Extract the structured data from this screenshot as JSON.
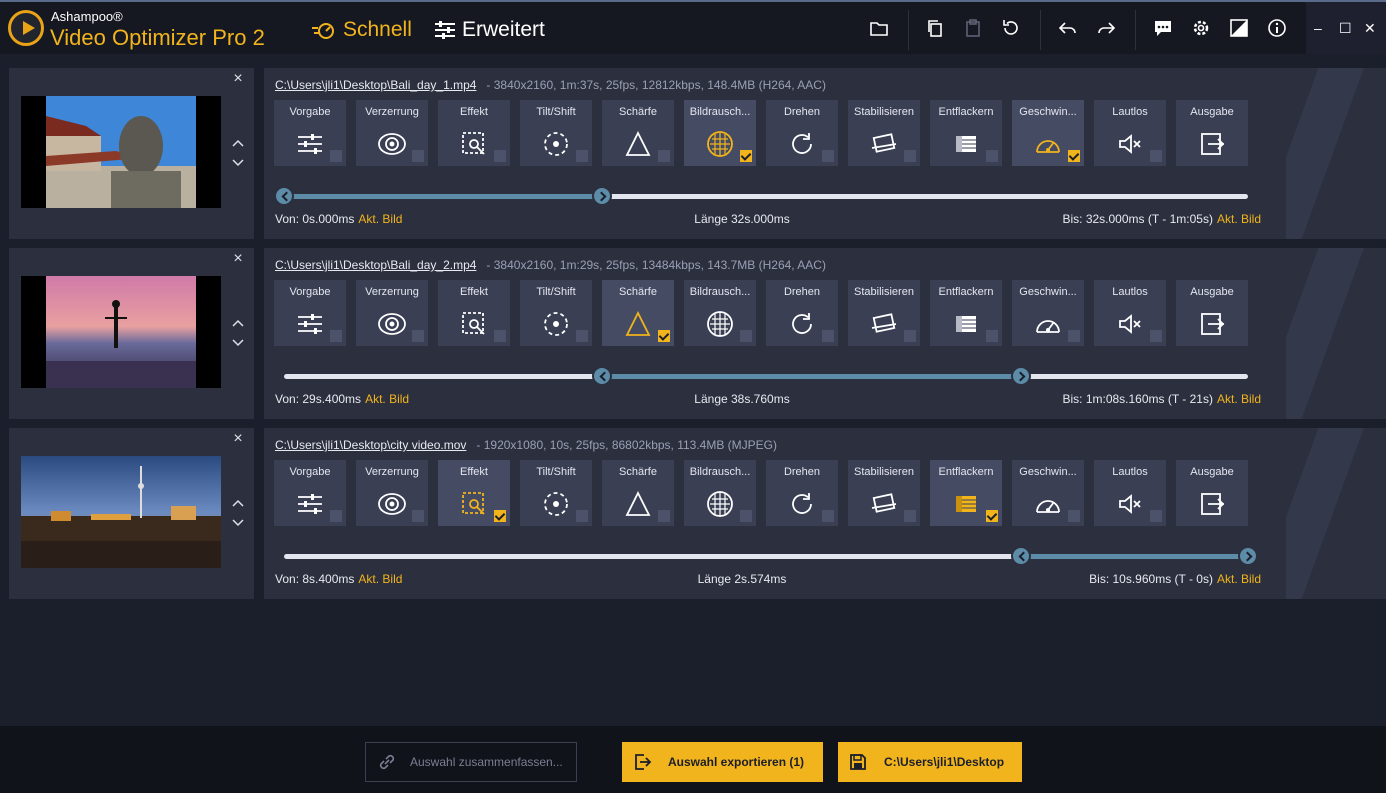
{
  "app": {
    "brand_small": "Ashampoo®",
    "brand_big": "Video Optimizer Pro 2"
  },
  "modes": [
    {
      "label": "Schnell",
      "active": true
    },
    {
      "label": "Erweitert",
      "active": false
    }
  ],
  "window_buttons": {
    "minimize": "–",
    "maximize": "☐",
    "close": "✕"
  },
  "tile_labels": [
    "Vorgabe",
    "Verzerrung",
    "Effekt",
    "Tilt/Shift",
    "Schärfe",
    "Bildrausch...",
    "Drehen",
    "Stabilisieren",
    "Entflackern",
    "Geschwin...",
    "Lautlos",
    "Ausgabe"
  ],
  "clips": [
    {
      "path": "C:\\Users\\jli1\\Desktop\\Bali_day_1.mp4",
      "meta": "-   3840x2160, 1m:37s, 25fps, 12812kbps, 148.4MB (H264, AAC)",
      "checked": [
        5,
        9
      ],
      "von": "Von:  0s.000ms",
      "laenge": "Länge  32s.000ms",
      "bis": "Bis:  32s.000ms (T - 1m:05s)",
      "akt": "Akt. Bild",
      "range_start": 0,
      "range_end": 0.33
    },
    {
      "path": "C:\\Users\\jli1\\Desktop\\Bali_day_2.mp4",
      "meta": "-   3840x2160, 1m:29s, 25fps, 13484kbps, 143.7MB (H264, AAC)",
      "checked": [
        4
      ],
      "von": "Von:  29s.400ms",
      "laenge": "Länge  38s.760ms",
      "bis": "Bis:  1m:08s.160ms (T - 21s)",
      "akt": "Akt. Bild",
      "range_start": 0.33,
      "range_end": 0.765
    },
    {
      "path": "C:\\Users\\jli1\\Desktop\\city video.mov",
      "meta": "-   1920x1080, 10s, 25fps, 86802kbps, 113.4MB (MJPEG)",
      "checked": [
        2,
        8
      ],
      "von": "Von:  8s.400ms",
      "laenge": "Länge  2s.574ms",
      "bis": "Bis:  10s.960ms (T - 0s)",
      "akt": "Akt. Bild",
      "range_start": 0.765,
      "range_end": 1.0
    }
  ],
  "bottom": {
    "merge_label": "Auswahl zusammenfassen...",
    "export_label": "Auswahl exportieren (1)",
    "dest_label": "C:\\Users\\jli1\\Desktop"
  },
  "colors": {
    "accent": "#f2b41c",
    "selection": "#5c8ca8",
    "tile": "#3a3f54",
    "panel": "#2b2f3e"
  }
}
